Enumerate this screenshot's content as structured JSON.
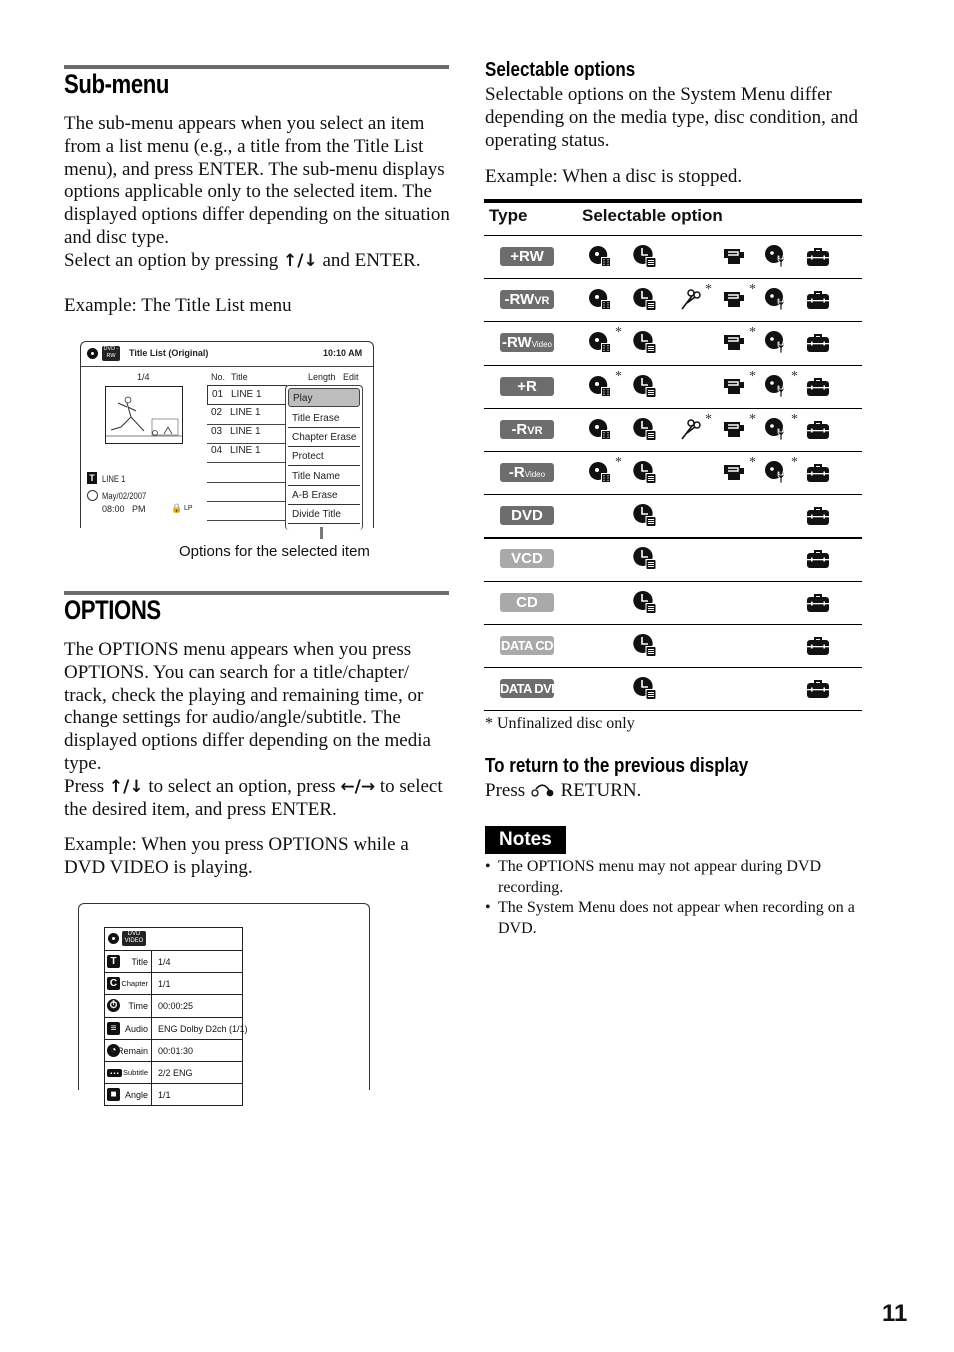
{
  "page_number": "11",
  "submenu_section": {
    "title": "Sub-menu",
    "paragraph": "The sub-menu appears when you select an item from a list menu (e.g., a title from the Title List menu), and press ENTER. The sub-menu displays options applicable only to the selected item. The displayed options differ depending on the situation and disc type.",
    "select_prefix": "Select an option by pressing",
    "select_arrows": "↑/↓",
    "select_suffix": "and ENTER.",
    "example": "Example: The Title List menu",
    "callout": "Options for the selected item",
    "screen": {
      "disc_badge": "DVD -RW",
      "title": "Title List (Original)",
      "clock": "10:10 AM",
      "page": "1/4",
      "col_no": "No.",
      "col_title": "Title",
      "col_length": "Length",
      "col_edit": "Edit",
      "rows": [
        {
          "no": "01",
          "title": "LINE 1"
        },
        {
          "no": "02",
          "title": "LINE 1"
        },
        {
          "no": "03",
          "title": "LINE 1"
        },
        {
          "no": "04",
          "title": "LINE 1"
        }
      ],
      "info_title": "LINE 1",
      "info_date": "May/02/2007",
      "info_time": "08:00   PM",
      "info_mode": "LP",
      "submenu_items": [
        "Play",
        "Title Erase",
        "Chapter Erase",
        "Protect",
        "Title Name",
        "A-B Erase",
        "Divide Title"
      ],
      "submenu_selected": "Play"
    }
  },
  "options_section": {
    "title": "OPTIONS",
    "paragraph": "The OPTIONS menu appears when you press OPTIONS. You can search for a title/chapter/ track, check the playing and remaining time, or change settings for audio/angle/subtitle. The displayed options differ depending on the media type.",
    "press_prefix": "Press",
    "press_arrows_ud": "↑/↓",
    "press_middle": "to select an option, press",
    "press_arrows_lr": "←/→",
    "press_suffix": "to select the desired item, and press ENTER.",
    "example": "Example: When you press OPTIONS while a DVD VIDEO is playing.",
    "screen": {
      "disc_badge": "DVD VIDEO",
      "rows": [
        {
          "icon": "title-icon",
          "glyph": "T",
          "label": "Title",
          "value": "1/4"
        },
        {
          "icon": "chapter-icon",
          "glyph": "C",
          "label": "Chapter",
          "value": "1/1"
        },
        {
          "icon": "time-icon",
          "glyph": "⏱",
          "label": "Time",
          "value": "00:00:25"
        },
        {
          "icon": "audio-icon",
          "glyph": "≡",
          "label": "Audio",
          "value": "ENG Dolby D2ch (1/1)"
        },
        {
          "icon": "remain-icon",
          "glyph": "◔",
          "label": "Remain",
          "value": "00:01:30"
        },
        {
          "icon": "subtitle-icon",
          "glyph": "…",
          "label": "Subtitle",
          "value": "2/2 ENG"
        },
        {
          "icon": "angle-icon",
          "glyph": "■",
          "label": "Angle",
          "value": "1/1"
        }
      ]
    }
  },
  "selectable_section": {
    "title": "Selectable options",
    "paragraph": "Selectable options on the System Menu differ depending on the media type, disc condition, and operating status.",
    "example": "Example: When a disc is stopped.",
    "col_type": "Type",
    "col_option": "Selectable option",
    "option_icons": [
      "title-list-icon",
      "timer-list-icon",
      "edit-scissors-icon",
      "camcorder-icon",
      "disc-setup-icon",
      "setup-toolbox-icon"
    ],
    "rows": [
      {
        "type": "+RW",
        "sub": "",
        "style": "dark",
        "options": [
          1,
          1,
          0,
          1,
          1,
          1
        ],
        "stars": [
          0,
          0,
          0,
          0,
          0,
          0
        ]
      },
      {
        "type": "-RW",
        "sub": "VR",
        "style": "dark",
        "options": [
          1,
          1,
          1,
          1,
          1,
          1
        ],
        "stars": [
          0,
          0,
          1,
          1,
          0,
          0
        ]
      },
      {
        "type": "-RW",
        "sub": "Video",
        "style": "dark",
        "options": [
          1,
          1,
          0,
          1,
          1,
          1
        ],
        "stars": [
          1,
          0,
          0,
          1,
          0,
          0
        ]
      },
      {
        "type": "+R",
        "sub": "",
        "style": "dark",
        "options": [
          1,
          1,
          0,
          1,
          1,
          1
        ],
        "stars": [
          1,
          0,
          0,
          1,
          1,
          0
        ]
      },
      {
        "type": "-R",
        "sub": "VR",
        "style": "dark",
        "options": [
          1,
          1,
          1,
          1,
          1,
          1
        ],
        "stars": [
          0,
          0,
          1,
          1,
          1,
          0
        ]
      },
      {
        "type": "-R",
        "sub": "Video",
        "style": "dark",
        "options": [
          1,
          1,
          0,
          1,
          1,
          1
        ],
        "stars": [
          1,
          0,
          0,
          1,
          1,
          0
        ]
      },
      {
        "type": "DVD",
        "sub": "",
        "style": "dark",
        "options": [
          0,
          1,
          0,
          0,
          0,
          1
        ],
        "stars": [
          0,
          0,
          0,
          0,
          0,
          0
        ]
      },
      {
        "type": "VCD",
        "sub": "",
        "style": "light",
        "options": [
          0,
          1,
          0,
          0,
          0,
          1
        ],
        "stars": [
          0,
          0,
          0,
          0,
          0,
          0
        ]
      },
      {
        "type": "CD",
        "sub": "",
        "style": "light",
        "options": [
          0,
          1,
          0,
          0,
          0,
          1
        ],
        "stars": [
          0,
          0,
          0,
          0,
          0,
          0
        ]
      },
      {
        "type": "DATA CD",
        "sub": "",
        "style": "light",
        "options": [
          0,
          1,
          0,
          0,
          0,
          1
        ],
        "stars": [
          0,
          0,
          0,
          0,
          0,
          0
        ]
      },
      {
        "type": "DATA DVD",
        "sub": "",
        "style": "dark",
        "options": [
          0,
          1,
          0,
          0,
          0,
          1
        ],
        "stars": [
          0,
          0,
          0,
          0,
          0,
          0
        ]
      }
    ],
    "footnote": "* Unfinalized disc only",
    "star": "*"
  },
  "return_section": {
    "title": "To return to the previous display",
    "press": "Press",
    "return_label": "RETURN."
  },
  "notes": {
    "badge": "Notes",
    "items": [
      "The OPTIONS menu may not appear during DVD recording.",
      "The System Menu does not appear when recording on a DVD."
    ]
  }
}
